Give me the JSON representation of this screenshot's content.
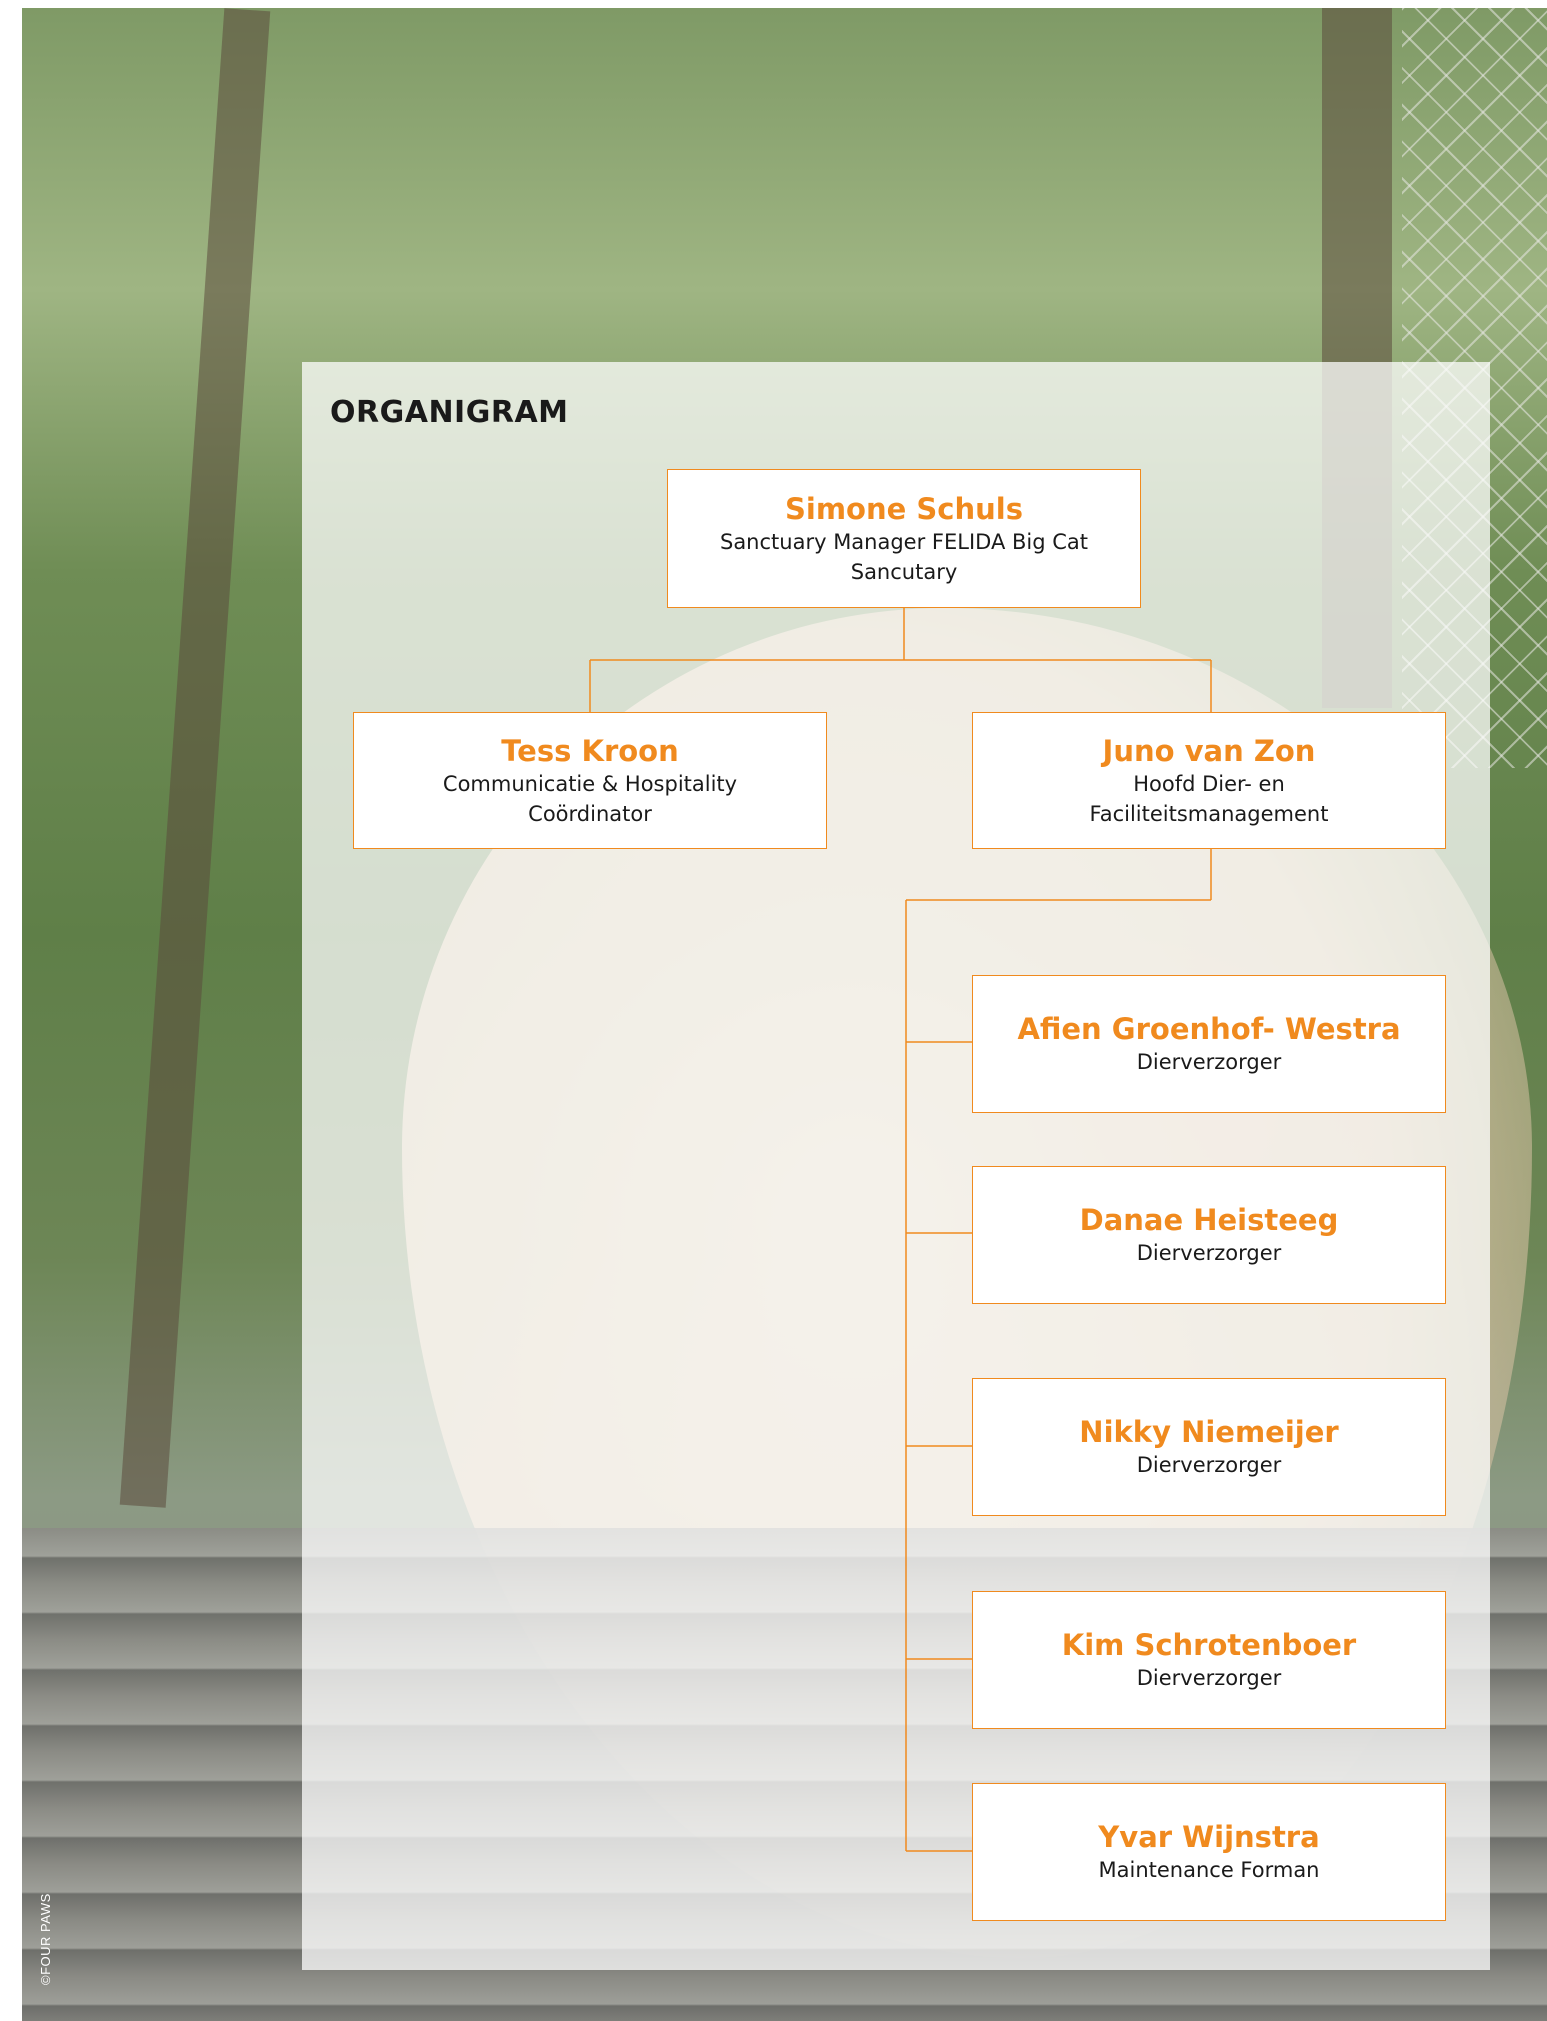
{
  "title": "ORGANIGRAM",
  "credit": "©FOUR PAWS",
  "colors": {
    "accent": "#f08a1e",
    "node_fill": "#ffffff",
    "text": "#1a1a1a"
  },
  "nodes": {
    "director": {
      "name": "Simone Schuls",
      "role": "Sanctuary Manager FELIDA Big Cat Sancutary"
    },
    "communication": {
      "name": "Tess Kroon",
      "role": "Communicatie & Hospitality Coördinator"
    },
    "head_animals": {
      "name": "Juno van Zon",
      "role": "Hoofd Dier- en Faciliteitsmanagement"
    },
    "staff": [
      {
        "name": "Afien Groenhof- Westra",
        "role": "Dierverzorger"
      },
      {
        "name": "Danae Heisteeg",
        "role": "Dierverzorger"
      },
      {
        "name": "Nikky Niemeijer",
        "role": "Dierverzorger"
      },
      {
        "name": "Kim Schrotenboer",
        "role": "Dierverzorger"
      },
      {
        "name": "Yvar Wijnstra",
        "role": "Maintenance Forman"
      }
    ]
  }
}
